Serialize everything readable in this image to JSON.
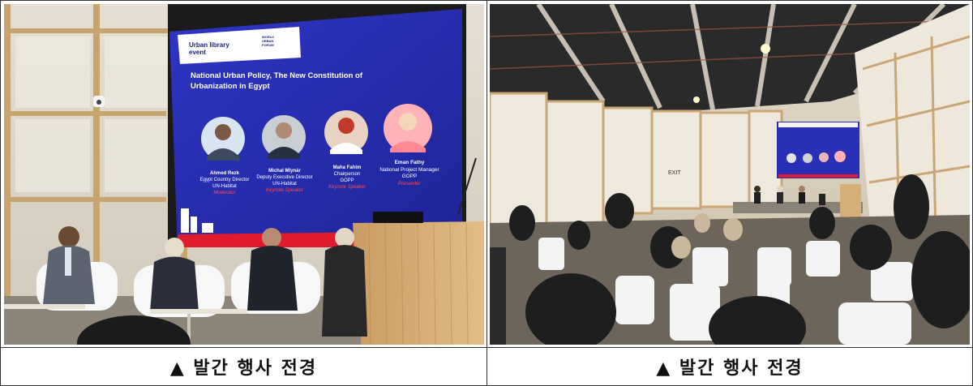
{
  "photos": [
    {
      "caption": "▲ 발간 행사 전경",
      "slide": {
        "brand_lines": [
          "Urban library",
          "event"
        ],
        "forum_lines": [
          "WORLD",
          "URBAN",
          "FORUM"
        ],
        "title_lines": [
          "National Urban Policy, The New Constitution of",
          "Urbanization in Egypt"
        ],
        "speakers": [
          {
            "name": "Ahmed Rezk",
            "title1": "Egypt Country Director",
            "title2": "UN-Habitat",
            "role": "Moderator"
          },
          {
            "name": "Michal Mlynár",
            "title1": "Deputy Executive Director",
            "title2": "UN-Habitat",
            "role": "Keynote Speaker"
          },
          {
            "name": "Maha Fahim",
            "title1": "Chairperson",
            "title2": "GOPP",
            "role": "Keynote Speaker"
          },
          {
            "name": "Eman Fathy",
            "title1": "National Project Manager",
            "title2": "GOPP",
            "role": "Presenter"
          }
        ]
      }
    },
    {
      "caption": "▲ 발간 행사 전경",
      "exit_sign": "EXIT"
    }
  ],
  "colors": {
    "slide_blue": "#2a2fb8",
    "slide_red": "#e01c2c",
    "role_red": "#ff4a4a",
    "border": "#333333"
  }
}
